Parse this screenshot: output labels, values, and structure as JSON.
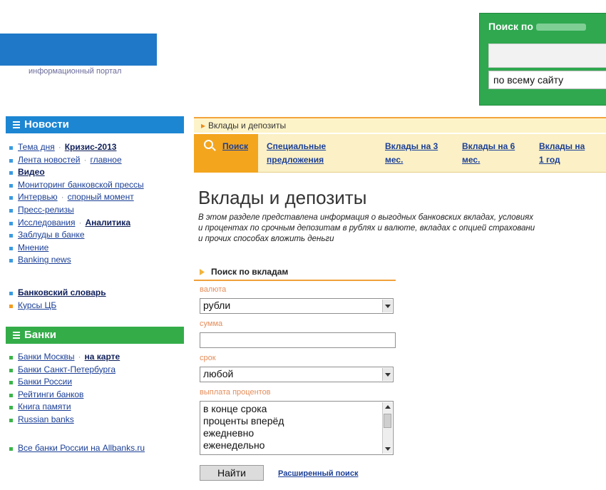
{
  "header": {
    "logo_subtitle": "информационный портал",
    "search": {
      "title": "Поиск по",
      "scope_value": "по всему сайту"
    }
  },
  "sidebar": {
    "news_heading": "Новости",
    "news_items": [
      [
        "Тема дня",
        "Кризис-2013"
      ],
      [
        "Лента новостей",
        "главное"
      ],
      [
        "Видео"
      ],
      [
        "Мониторинг банковской прессы"
      ],
      [
        "Интервью",
        "спорный момент"
      ],
      [
        "Пресс-релизы"
      ],
      [
        "Исследования",
        "Аналитика"
      ],
      [
        "Заблуды в банке"
      ],
      [
        "Мнение"
      ],
      [
        "Banking news"
      ]
    ],
    "dictionary": "Банковский словарь",
    "cbr_rates": "Курсы ЦБ",
    "banks_heading": "Банки",
    "banks_items": [
      [
        "Банки Москвы",
        "на карте"
      ],
      [
        "Банки Санкт-Петербурга"
      ],
      [
        "Банки России"
      ],
      [
        "Рейтинги банков"
      ],
      [
        "Книга памяти"
      ],
      [
        "Russian banks"
      ]
    ],
    "all_banks": "Все банки России на Allbanks.ru"
  },
  "breadcrumb": "Вклады и депозиты",
  "nav": {
    "search": "Поиск",
    "special_1": "Специальные",
    "special_2": "предложения",
    "m3_1": "Вклады на 3",
    "m3_2": "мес.",
    "m6_1": "Вклады на 6",
    "m6_2": "мес.",
    "y1_1": "Вклады на",
    "y1_2": "1 год"
  },
  "page_title": "Вклады и депозиты",
  "intro_lines": [
    "В этом разделе представлена информация о выгодных банковских вкладах, условиях",
    "и процентах по срочным депозитам в рублях и валюте, вкладах с опцией страховани",
    "и прочих способах вложить деньги"
  ],
  "form": {
    "heading": "Поиск по вкладам",
    "currency_label": "валюта",
    "currency_value": "рубли",
    "amount_label": "сумма",
    "amount_value": "",
    "term_label": "срок",
    "term_value": "любой",
    "payout_label": "выплата процентов",
    "payout_options": [
      "в конце срока",
      "проценты вперёд",
      "ежедневно",
      "еженедельно"
    ],
    "submit_label": "Найти",
    "advanced_label": "Расширенный поиск"
  }
}
